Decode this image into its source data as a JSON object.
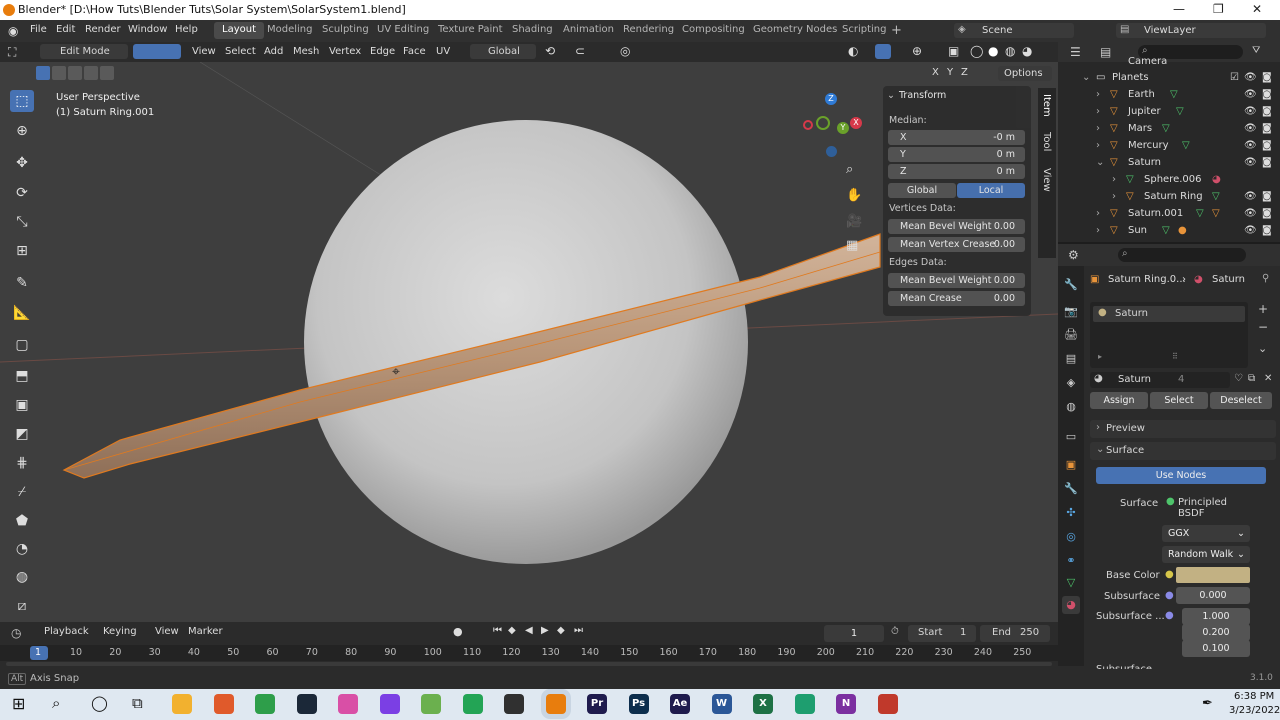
{
  "window": {
    "title": "Blender* [D:\\How Tuts\\Blender Tuts\\Solar System\\SolarSystem1.blend]"
  },
  "menu": [
    "File",
    "Edit",
    "Render",
    "Window",
    "Help"
  ],
  "workspaces": [
    "Layout",
    "Modeling",
    "Sculpting",
    "UV Editing",
    "Texture Paint",
    "Shading",
    "Animation",
    "Rendering",
    "Compositing",
    "Geometry Nodes",
    "Scripting"
  ],
  "scene": "Scene",
  "view_layer": "ViewLayer",
  "viewport_header": {
    "mode": "Edit Mode",
    "items": [
      "View",
      "Select",
      "Add",
      "Mesh",
      "Vertex",
      "Edge",
      "Face",
      "UV"
    ],
    "orientation": "Global",
    "options": "Options",
    "axes": [
      "X",
      "Y",
      "Z"
    ]
  },
  "viewport": {
    "perspective": "User Perspective",
    "object": "(1) Saturn Ring.001"
  },
  "gizmo": {
    "x": "X",
    "y": "Y",
    "z": "Z"
  },
  "npanel": {
    "title": "Transform",
    "median_label": "Median:",
    "x_label": "X",
    "x_value": "-0 m",
    "y_label": "Y",
    "y_value": "0 m",
    "z_label": "Z",
    "z_value": "0 m",
    "global": "Global",
    "local": "Local",
    "vertices_label": "Vertices Data:",
    "mean_bevel_weight": "Mean Bevel Weight",
    "mean_bevel_weight_v": "0.00",
    "mean_vertex_crease": "Mean Vertex Crease",
    "mean_vertex_crease_v": "0.00",
    "edges_label": "Edges Data:",
    "edge_mean_bevel_weight": "Mean Bevel Weight",
    "edge_mean_bevel_weight_v": "0.00",
    "mean_crease": "Mean Crease",
    "mean_crease_v": "0.00",
    "tabs": [
      "Item",
      "Tool",
      "View"
    ]
  },
  "outliner": {
    "rows": [
      {
        "name": "Camera",
        "indent": 0
      },
      {
        "name": "Planets",
        "indent": 0
      },
      {
        "name": "Earth",
        "indent": 1
      },
      {
        "name": "Jupiter",
        "indent": 1
      },
      {
        "name": "Mars",
        "indent": 1
      },
      {
        "name": "Mercury",
        "indent": 1
      },
      {
        "name": "Saturn",
        "indent": 1
      },
      {
        "name": "Sphere.006",
        "indent": 2
      },
      {
        "name": "Saturn Ring",
        "indent": 2
      },
      {
        "name": "Saturn.001",
        "indent": 1
      },
      {
        "name": "Sun",
        "indent": 1
      }
    ]
  },
  "properties": {
    "breadcrumb_object": "Saturn Ring.0...",
    "breadcrumb_material": "Saturn",
    "slot_name": "Saturn",
    "material_name": "Saturn",
    "users": "4",
    "assign": "Assign",
    "select": "Select",
    "deselect": "Deselect",
    "preview": "Preview",
    "surface_section": "Surface",
    "use_nodes": "Use Nodes",
    "surface_label": "Surface",
    "surface_value": "Principled BSDF",
    "distribution": "GGX",
    "subsurface_method": "Random Walk",
    "base_color_label": "Base Color",
    "base_color": "#c2b183",
    "subsurface_label": "Subsurface",
    "subsurface_value": "0.000",
    "subsurface_radius_label": "Subsurface ...",
    "subsurface_radius": [
      "1.000",
      "0.200",
      "0.100"
    ],
    "subsurface_color_label": "Subsurface ..."
  },
  "timeline": {
    "menus": [
      "Playback",
      "Keying",
      "View",
      "Marker"
    ],
    "current_frame": "1",
    "start_label": "Start",
    "start": "1",
    "end_label": "End",
    "end": "250",
    "ruler": [
      "1",
      "10",
      "20",
      "30",
      "40",
      "50",
      "60",
      "70",
      "80",
      "90",
      "100",
      "110",
      "120",
      "130",
      "140",
      "150",
      "160",
      "170",
      "180",
      "190",
      "200",
      "210",
      "220",
      "230",
      "240",
      "250"
    ]
  },
  "status": {
    "left": "Axis Snap",
    "version": "3.1.0"
  },
  "taskbar": {
    "time": "6:38 PM",
    "date": "3/23/2022",
    "apps": [
      {
        "name": "file-explorer",
        "color": "#f2b12f",
        "label": ""
      },
      {
        "name": "git",
        "color": "#e05a2b",
        "label": ""
      },
      {
        "name": "chrome",
        "color": "#2e9e4a",
        "label": ""
      },
      {
        "name": "steam",
        "color": "#1b2838",
        "label": ""
      },
      {
        "name": "itunes",
        "color": "#d94fa6",
        "label": ""
      },
      {
        "name": "twitch",
        "color": "#7b3fe4",
        "label": ""
      },
      {
        "name": "notepad",
        "color": "#6bb04e",
        "label": ""
      },
      {
        "name": "app-green",
        "color": "#23a455",
        "label": ""
      },
      {
        "name": "obs",
        "color": "#303030",
        "label": ""
      },
      {
        "name": "blender",
        "color": "#e87d0d",
        "label": ""
      },
      {
        "name": "premiere",
        "color": "#1f1b4d",
        "label": "Pr"
      },
      {
        "name": "photoshop",
        "color": "#0d2e4d",
        "label": "Ps"
      },
      {
        "name": "after-effects",
        "color": "#1f1b4d",
        "label": "Ae"
      },
      {
        "name": "word",
        "color": "#2b5797",
        "label": "W"
      },
      {
        "name": "excel",
        "color": "#1e7145",
        "label": "X"
      },
      {
        "name": "app-teal",
        "color": "#1e9e6f",
        "label": ""
      },
      {
        "name": "onenote",
        "color": "#7b2fa0",
        "label": "N"
      },
      {
        "name": "app-red",
        "color": "#c0392b",
        "label": ""
      }
    ]
  }
}
